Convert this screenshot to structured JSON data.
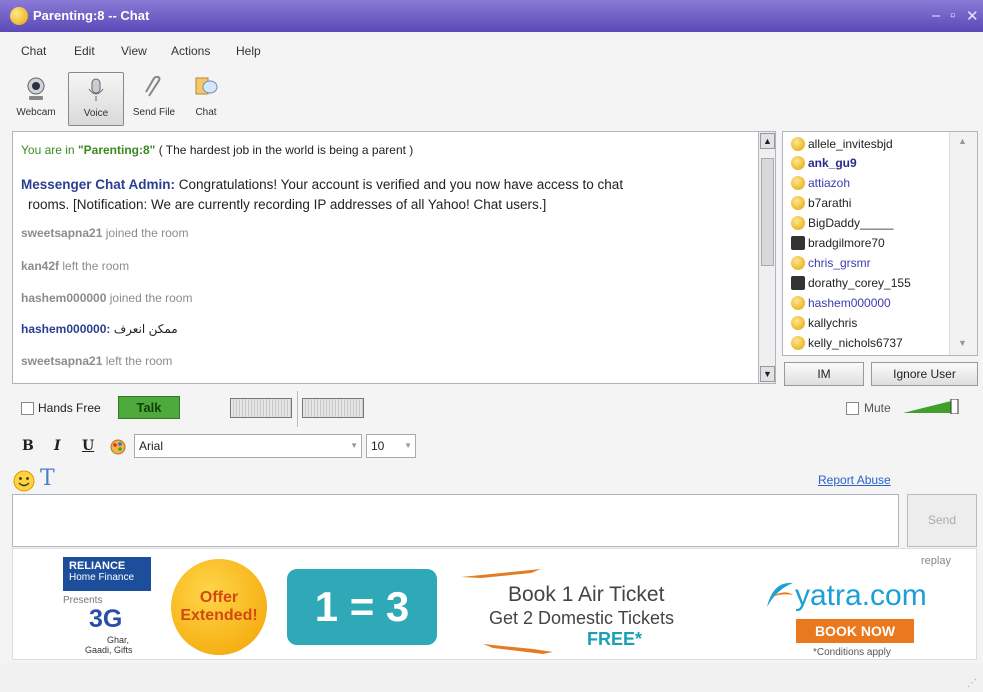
{
  "window": {
    "title": "Parenting:8 -- Chat"
  },
  "menu": [
    "Chat",
    "Edit",
    "View",
    "Actions",
    "Help"
  ],
  "toolbar": [
    {
      "label": "Webcam",
      "icon": "webcam-icon"
    },
    {
      "label": "Voice",
      "icon": "microphone-icon"
    },
    {
      "label": "Send File",
      "icon": "paperclip-icon"
    },
    {
      "label": "Chat",
      "icon": "chat-bubble-icon"
    }
  ],
  "room": {
    "prefix": "You are in",
    "name": "\"Parenting:8\"",
    "topic": "( The hardest job in the world is being a parent )"
  },
  "messages": [
    {
      "user": "Messenger Chat Admin:",
      "text": "Congratulations! Your account is verified and you now have access to chat",
      "text2": "rooms. [Notification: We are currently recording IP addresses of all Yahoo! Chat users.]"
    },
    {
      "user": "sweetsapna21",
      "text": "joined the room"
    },
    {
      "user": "kan42f",
      "text": "left the room"
    },
    {
      "user": "hashem000000",
      "text": "joined the room"
    },
    {
      "user": "hashem000000:",
      "text": "ممكن انعرف"
    },
    {
      "user": "sweetsapna21",
      "text": "left the room"
    }
  ],
  "users": [
    {
      "name": "allele_invitesbjd",
      "style": "normal"
    },
    {
      "name": "ank_gu9",
      "style": "bold"
    },
    {
      "name": "attiazoh",
      "style": "link"
    },
    {
      "name": "b7arathi",
      "style": "normal"
    },
    {
      "name": "BigDaddy_____",
      "style": "normal"
    },
    {
      "name": "bradgilmore70",
      "style": "normal"
    },
    {
      "name": "chris_grsmr",
      "style": "link"
    },
    {
      "name": "dorathy_corey_155",
      "style": "normal"
    },
    {
      "name": "hashem000000",
      "style": "link"
    },
    {
      "name": "kallychris",
      "style": "normal"
    },
    {
      "name": "kelly_nichols6737",
      "style": "normal"
    }
  ],
  "user_buttons": {
    "im": "IM",
    "ignore": "Ignore User"
  },
  "voice": {
    "hands_free": "Hands Free",
    "talk": "Talk",
    "mute": "Mute"
  },
  "format": {
    "bold": "B",
    "italic": "I",
    "underline": "U",
    "font": "Arial",
    "size": "10"
  },
  "links": {
    "report_abuse": "Report Abuse"
  },
  "send": "Send",
  "ad": {
    "replay": "replay",
    "reliance_line1": "RELIANCE",
    "reliance_line2": "Home Finance",
    "presents": "Presents",
    "three_g": "3G",
    "three_g_sub1": "Ghar,",
    "three_g_sub2": "Gaadi, Gifts",
    "offer_line1": "Offer",
    "offer_line2": "Extended!",
    "equation": "1 = 3",
    "headline": "Book 1 Air Ticket",
    "subline": "Get 2 Domestic Tickets",
    "free": "FREE*",
    "brand": "yatra.com",
    "book_now": "BOOK NOW",
    "conditions": "*Conditions apply"
  }
}
